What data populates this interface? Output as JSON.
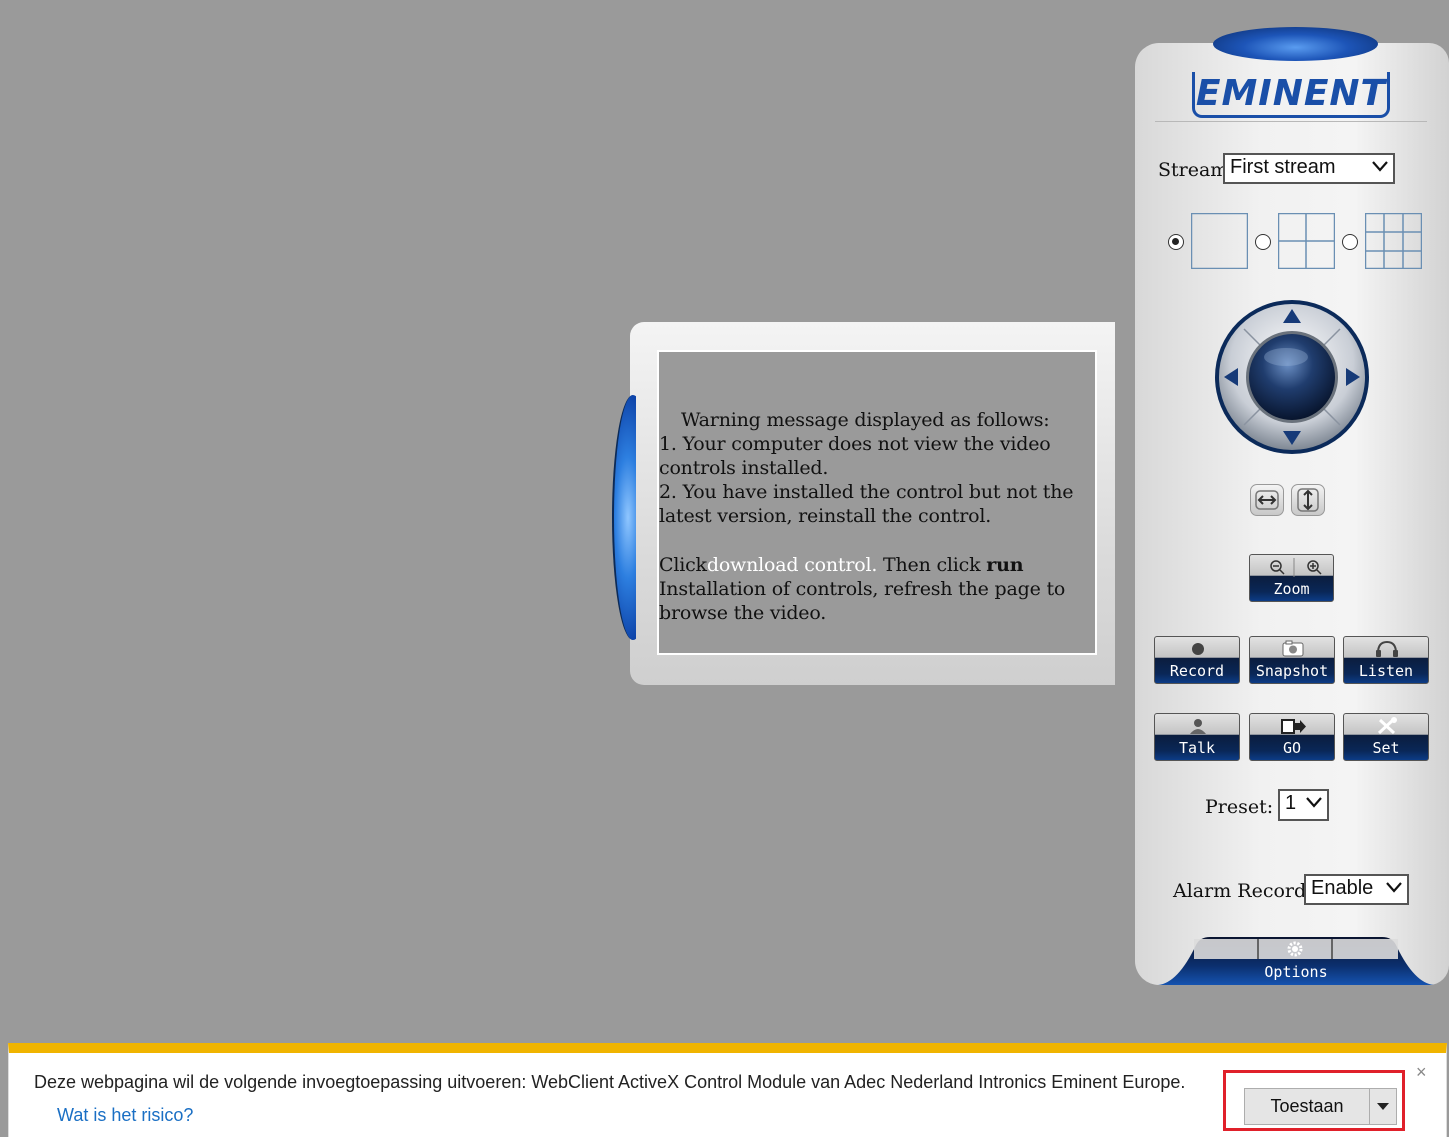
{
  "warning": {
    "heading": "Warning message displayed as follows:",
    "line1": "1. Your computer does not view the video controls installed.",
    "line2": "2. You have installed the control but not the latest version, reinstall the control.",
    "click_prefix": "Click",
    "download_link": "download control.",
    "then_click": " Then click ",
    "run_word": "run",
    "instruction_suffix": " Installation of controls, refresh the page to browse the video."
  },
  "panel": {
    "brand": "EMINENT",
    "stream_label": "Stream:",
    "stream_value": "First stream",
    "layout_selected": "1x1",
    "buttons": {
      "zoom": "Zoom",
      "record": "Record",
      "snapshot": "Snapshot",
      "listen": "Listen",
      "talk": "Talk",
      "go": "GO",
      "set": "Set",
      "options": "Options"
    },
    "preset_label": "Preset:",
    "preset_value": "1",
    "alarm_label": "Alarm Record:",
    "alarm_value": "Enable"
  },
  "infobar": {
    "message": "Deze webpagina wil de volgende invoegtoepassing uitvoeren: WebClient ActiveX Control Module van Adec Nederland Intronics Eminent Europe.",
    "risk_link": "Wat is het risico?",
    "allow_button": "Toestaan",
    "close_symbol": "×",
    "accent_color": "#f0b400",
    "highlight_color": "#e0202a"
  }
}
